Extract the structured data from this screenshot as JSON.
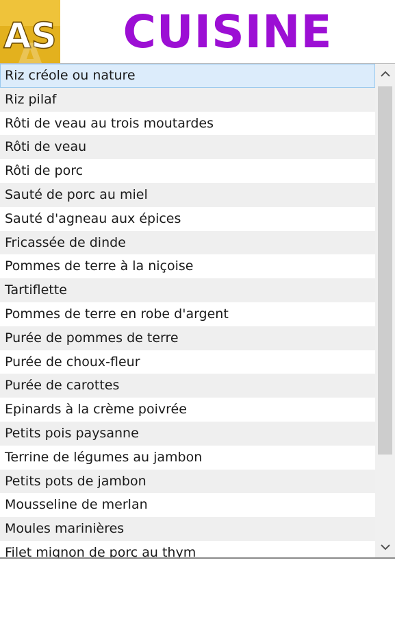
{
  "header": {
    "logo_text": "AS",
    "title": "CUISINE"
  },
  "colors": {
    "title": "#9c0fd4",
    "logo_bg": "#e3b11e",
    "selection": "#dcecfb"
  },
  "icons": {
    "scroll_up": "chevron-up-icon",
    "scroll_down": "chevron-down-icon"
  },
  "list": {
    "selected_index": 0,
    "items": [
      "Riz créole ou nature",
      "Riz pilaf",
      "Rôti de veau au trois moutardes",
      "Rôti de veau",
      "Rôti de porc",
      "Sauté de porc au miel",
      "Sauté d'agneau aux épices",
      "Fricassée de dinde",
      "Pommes de terre à la niçoise",
      "Tartiflette",
      "Pommes de terre en robe d'argent",
      "Purée de pommes de terre",
      "Purée de choux-fleur",
      "Purée de carottes",
      "Epinards à la crème poivrée",
      "Petits pois paysanne",
      "Terrine de légumes au jambon",
      "Petits pots de jambon",
      "Mousseline de merlan",
      "Moules marinières",
      "Filet mignon de porc au thym"
    ]
  }
}
